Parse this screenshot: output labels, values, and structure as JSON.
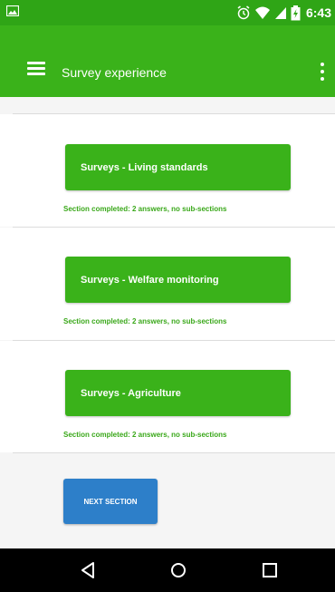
{
  "status_bar": {
    "time": "6:43",
    "icons": [
      "image-notification-icon",
      "alarm-icon",
      "wifi-icon",
      "signal-icon",
      "battery-icon"
    ]
  },
  "toolbar": {
    "title": "Survey experience",
    "menu_icon": "hamburger-menu-icon",
    "overflow_icon": "more-vert-icon"
  },
  "sections": [
    {
      "label": "Surveys - Living standards",
      "status": "Section completed: 2 answers, no sub-sections"
    },
    {
      "label": "Surveys - Welfare monitoring",
      "status": "Section completed: 2 answers, no sub-sections"
    },
    {
      "label": "Surveys - Agriculture",
      "status": "Section completed: 2 answers, no sub-sections"
    }
  ],
  "next_button": {
    "label": "NEXT SECTION"
  },
  "nav_bar": {
    "icons": [
      "back-icon",
      "home-icon",
      "recents-icon"
    ]
  },
  "colors": {
    "status_bar": "#2fa516",
    "toolbar": "#3ab21a",
    "section_button": "#3ab21a",
    "section_status_text": "#3aa81a",
    "next_button": "#2d7fc9",
    "nav_bar": "#000000"
  }
}
